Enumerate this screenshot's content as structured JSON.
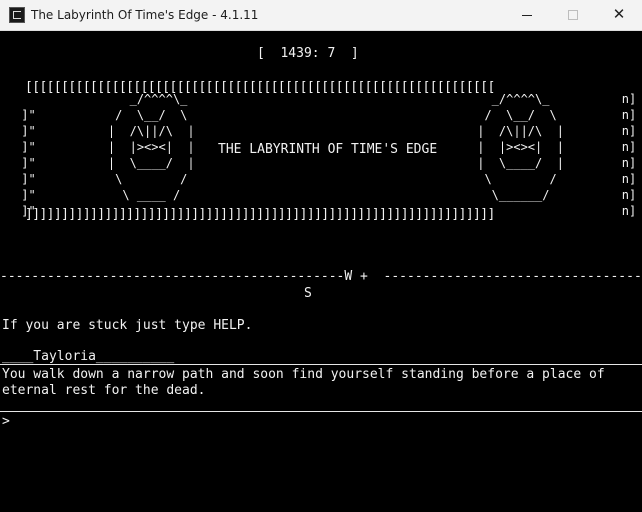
{
  "window": {
    "title": "The Labyrinth Of Time's Edge - 4.1.11",
    "app_icon": "terminal-app-icon",
    "controls": {
      "minimize_icon": "minimize-icon",
      "maximize_icon": "maximize-icon",
      "close_icon": "close-icon",
      "close_glyph": "✕"
    }
  },
  "status": {
    "counter": "[  1439: 7  ]"
  },
  "banner": {
    "top_border": "[[[[[[[[[[[[[[[[[[[[[[[[[[[[[[[[[[[[[[[[[[[[[[[[[[[[[[[[[[[[[[[[[",
    "bottom_border": "]]]]]]]]]]]]]]]]]]]]]]]]]]]]]]]]]]]]]]]]]]]]]]]]]]]]]]]]]]]]]]]]]",
    "title": "THE LABYRINTH OF TIME'S EDGE",
    "left_art": "                _/^^^^\\_\n ]\"           /  \\__/  \\\n ]\"          |  /\\||/\\  |\n ]\"          |  |><><|  |\n ]\"          |  \\____/  |\n ]\"           \\        /\n ]\"            \\ ____ /\n ]\"",
    "right_art": "   _/^^^^\\_          n]\n  /  \\__/  \\         n]\n |  /\\||/\\  |        n]\n |  |><><|  |        n]\n |  \\____/  |        n]\n  \\        /         n]\n   \\______/          n]\n                     n]"
  },
  "compass": {
    "row": "--------------------------------------------W +  ----------------------------------------",
    "south": "S"
  },
  "messages": {
    "help": "If you are stuck just type HELP.",
    "location": "____Tayloria__________",
    "description": "You walk down a narrow path and soon find yourself standing before a place of\neternal rest for the dead."
  },
  "input": {
    "prompt": ">"
  }
}
